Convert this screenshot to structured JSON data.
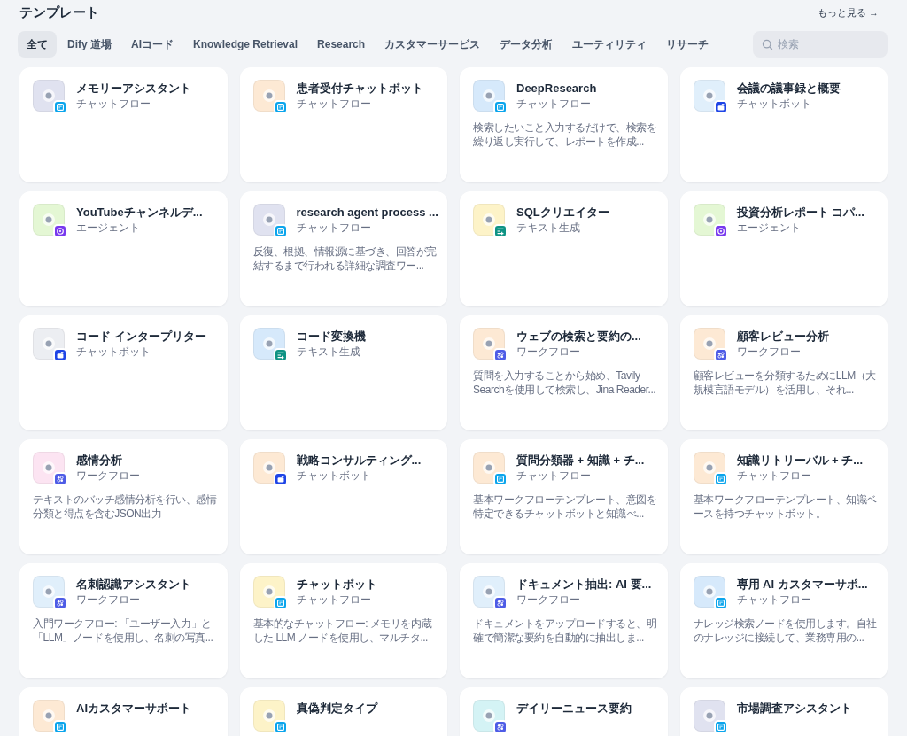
{
  "header": {
    "title": "テンプレート",
    "more_link": "もっと見る →"
  },
  "tabs": [
    {
      "label": "全て",
      "selected": true
    },
    {
      "label": "Dify 道場",
      "selected": false
    },
    {
      "label": "AIコード",
      "selected": false
    },
    {
      "label": "Knowledge Retrieval",
      "selected": false
    },
    {
      "label": "Research",
      "selected": false
    },
    {
      "label": "カスタマーサービス",
      "selected": false
    },
    {
      "label": "データ分析",
      "selected": false
    },
    {
      "label": "ユーティリティ",
      "selected": false
    },
    {
      "label": "リサーチ",
      "selected": false
    }
  ],
  "search": {
    "placeholder": "検索"
  },
  "cards": [
    {
      "title": "メモリーアシスタント",
      "type": "チャットフロー",
      "kind": "chatflow",
      "color": "#e0e2f0"
    },
    {
      "title": "患者受付チャットボット",
      "type": "チャットフロー",
      "kind": "chatflow",
      "color": "#fde9d4"
    },
    {
      "title": "DeepResearch",
      "type": "チャットフロー",
      "kind": "chatflow",
      "color": "#d6e9fb",
      "description": "検索したいこと入力するだけで、検索を繰り返し実行して、レポートを作成..."
    },
    {
      "title": "会議の議事録と概要",
      "type": "チャットボット",
      "kind": "chatbot",
      "color": "#e0effb"
    },
    {
      "title": "YouTubeチャンネルデ...",
      "type": "エージェント",
      "kind": "agent",
      "color": "#e4f7d4"
    },
    {
      "title": "research agent process ...",
      "type": "チャットフロー",
      "kind": "chatflow",
      "color": "#e0e2f0",
      "description": "反復、根拠、情報源に基づき、回答が完結するまで行われる詳細な調査ワー..."
    },
    {
      "title": "SQLクリエイター",
      "type": "テキスト生成",
      "kind": "completion",
      "color": "#fdf3c8"
    },
    {
      "title": "投資分析レポート コパ...",
      "type": "エージェント",
      "kind": "agent",
      "color": "#e4f7d4"
    },
    {
      "title": "コード インタープリター",
      "type": "チャットボット",
      "kind": "chatbot",
      "color": "#eceef2"
    },
    {
      "title": "コード変換機",
      "type": "テキスト生成",
      "kind": "completion",
      "color": "#d6e9fb"
    },
    {
      "title": "ウェブの検索と要約の...",
      "type": "ワークフロー",
      "kind": "workflow",
      "color": "#fde9d4",
      "description": "質問を入力することから始め、Tavily Searchを使用して検索し、Jina Reader..."
    },
    {
      "title": "顧客レビュー分析",
      "type": "ワークフロー",
      "kind": "workflow",
      "color": "#fde9d4",
      "description": "顧客レビューを分類するためにLLM（大規模言語モデル）を活用し、それ..."
    },
    {
      "title": "感情分析",
      "type": "ワークフロー",
      "kind": "workflow",
      "color": "#fce4f2",
      "description": "テキストのバッチ感情分析を行い、感情分類と得点を含むJSON出力"
    },
    {
      "title": "戦略コンサルティング...",
      "type": "チャットボット",
      "kind": "chatbot",
      "color": "#fde9d4"
    },
    {
      "title": "質問分類器 + 知識 + チ...",
      "type": "チャットフロー",
      "kind": "chatflow",
      "color": "#fde9d4",
      "description": "基本ワークフローテンプレート、意図を特定できるチャットボットと知識べ..."
    },
    {
      "title": "知識リトリーバル + チ...",
      "type": "チャットフロー",
      "kind": "chatflow",
      "color": "#fde9d4",
      "description": "基本ワークフローテンプレート、知識ベースを持つチャットボット。"
    },
    {
      "title": "名刺認識アシスタント",
      "type": "ワークフロー",
      "kind": "workflow",
      "color": "#e0effb",
      "description": "入門ワークフロー: 「ユーザー入力」と「LLM」ノードを使用し、名刺の写真..."
    },
    {
      "title": "チャットボット",
      "type": "チャットフロー",
      "kind": "chatflow",
      "color": "#fdf3c8",
      "description": "基本的なチャットフロー: メモリを内蔵した LLM ノードを使用し、マルチタ..."
    },
    {
      "title": "ドキュメント抽出: AI 要...",
      "type": "ワークフロー",
      "kind": "workflow",
      "color": "#e0effb",
      "description": "ドキュメントをアップロードすると、明確で簡潔な要約を自動的に抽出しま..."
    },
    {
      "title": "専用 AI カスタマーサポ...",
      "type": "チャットフロー",
      "kind": "chatflow",
      "color": "#d6e9fb",
      "description": "ナレッジ検索ノードを使用します。自社のナレッジに接続して、業務専用の..."
    },
    {
      "title": "AIカスタマーサポート",
      "kind": "chatflow",
      "color": "#fde9d4"
    },
    {
      "title": "真偽判定タイプ",
      "kind": "chatflow",
      "color": "#fdf3c8"
    },
    {
      "title": "デイリーニュース要約",
      "kind": "workflow",
      "color": "#d4f3f5"
    },
    {
      "title": "市場調査アシスタント",
      "kind": "chatflow",
      "color": "#e0e2f0"
    }
  ]
}
